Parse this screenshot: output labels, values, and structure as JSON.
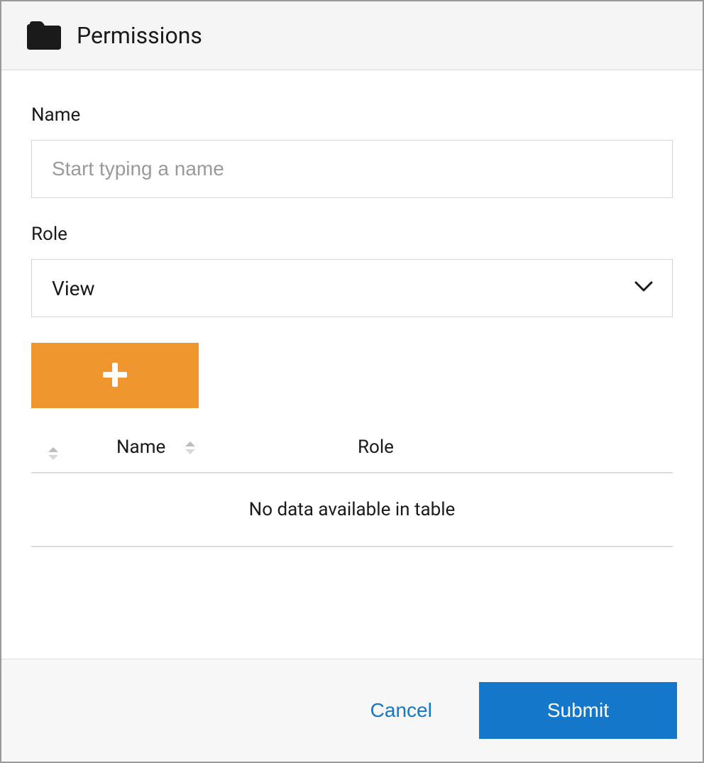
{
  "header": {
    "title": "Permissions"
  },
  "form": {
    "name_label": "Name",
    "name_placeholder": "Start typing a name",
    "name_value": "",
    "role_label": "Role",
    "role_selected": "View"
  },
  "table": {
    "columns": {
      "name": "Name",
      "role": "Role"
    },
    "empty_message": "No data available in table"
  },
  "footer": {
    "cancel_label": "Cancel",
    "submit_label": "Submit"
  }
}
